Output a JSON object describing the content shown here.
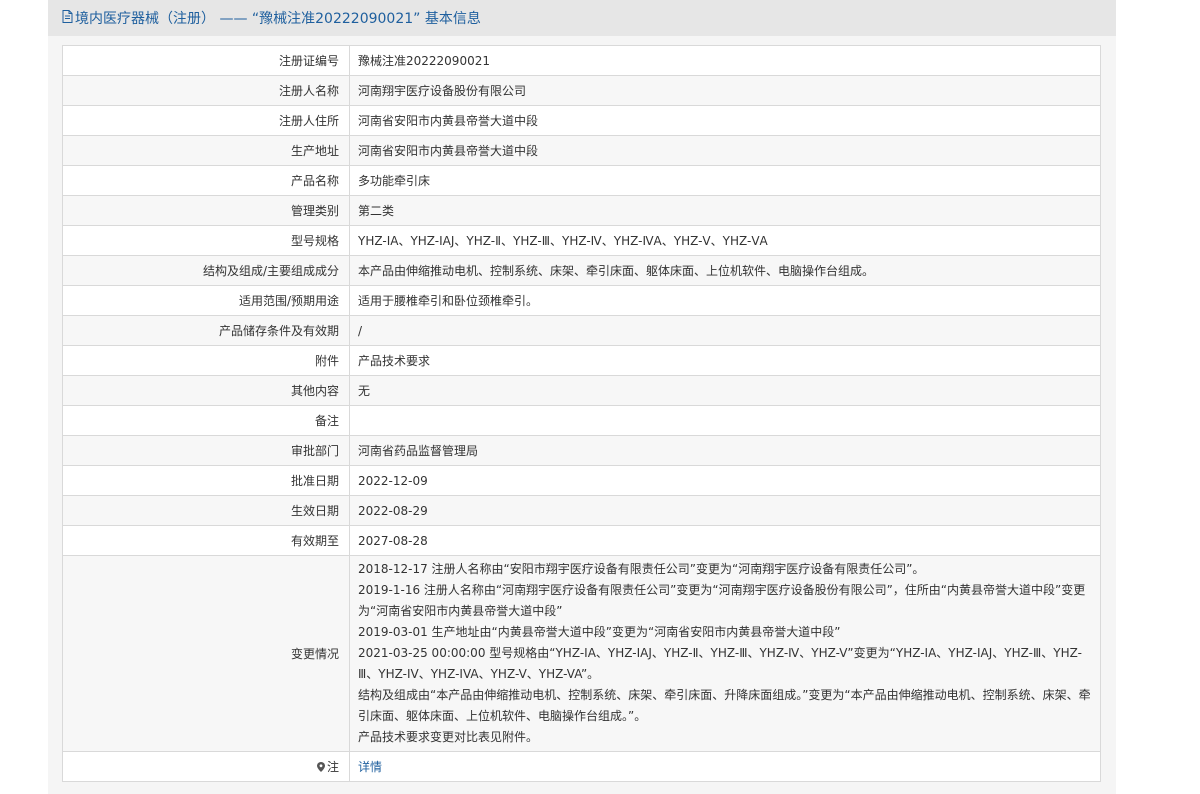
{
  "header": {
    "title": "境内医疗器械（注册） —— “豫械注准20222090021” 基本信息"
  },
  "rows": [
    {
      "label": "注册证编号",
      "value": "豫械注准20222090021"
    },
    {
      "label": "注册人名称",
      "value": "河南翔宇医疗设备股份有限公司"
    },
    {
      "label": "注册人住所",
      "value": "河南省安阳市内黄县帝誉大道中段"
    },
    {
      "label": "生产地址",
      "value": "河南省安阳市内黄县帝誉大道中段"
    },
    {
      "label": "产品名称",
      "value": "多功能牵引床"
    },
    {
      "label": "管理类别",
      "value": "第二类"
    },
    {
      "label": "型号规格",
      "value": "YHZ-ⅠA、YHZ-ⅠAJ、YHZ-Ⅱ、YHZ-Ⅲ、YHZ-Ⅳ、YHZ-ⅣA、YHZ-Ⅴ、YHZ-ⅤA"
    },
    {
      "label": "结构及组成/主要组成成分",
      "value": "本产品由伸缩推动电机、控制系统、床架、牵引床面、躯体床面、上位机软件、电脑操作台组成。"
    },
    {
      "label": "适用范围/预期用途",
      "value": "适用于腰椎牵引和卧位颈椎牵引。"
    },
    {
      "label": "产品储存条件及有效期",
      "value": "/"
    },
    {
      "label": "附件",
      "value": "产品技术要求"
    },
    {
      "label": "其他内容",
      "value": "无"
    },
    {
      "label": "备注",
      "value": ""
    },
    {
      "label": "审批部门",
      "value": "河南省药品监督管理局"
    },
    {
      "label": "批准日期",
      "value": "2022-12-09"
    },
    {
      "label": "生效日期",
      "value": "2022-08-29"
    },
    {
      "label": "有效期至",
      "value": "2027-08-28"
    }
  ],
  "changes": {
    "label": "变更情况",
    "lines": [
      "2018-12-17 注册人名称由“安阳市翔宇医疗设备有限责任公司”变更为“河南翔宇医疗设备有限责任公司”。",
      "2019-1-16 注册人名称由“河南翔宇医疗设备有限责任公司”变更为“河南翔宇医疗设备股份有限公司”，住所由“内黄县帝誉大道中段”变更为“河南省安阳市内黄县帝誉大道中段”",
      "2019-03-01 生产地址由“内黄县帝誉大道中段”变更为“河南省安阳市内黄县帝誉大道中段”",
      "2021-03-25 00:00:00 型号规格由“YHZ-IA、YHZ-IAJ、YHZ-Ⅱ、YHZ-Ⅲ、YHZ-Ⅳ、YHZ-V”变更为“YHZ-IA、YHZ-IAJ、YHZ-Ⅲ、YHZ-Ⅲ、YHZ-IV、YHZ-IVA、YHZ-V、YHZ-VA”。",
      "结构及组成由“本产品由伸缩推动电机、控制系统、床架、牵引床面、升降床面组成。”变更为“本产品由伸缩推动电机、控制系统、床架、牵引床面、躯体床面、上位机软件、电脑操作台组成。”。",
      "产品技术要求变更对比表见附件。"
    ]
  },
  "note": {
    "label": "注",
    "link": "详情"
  },
  "icons": {
    "header_icon": "document-icon",
    "note_icon": "map-pin-icon"
  },
  "colors": {
    "link": "#1e5f9e",
    "header_bg": "#e6e6e6",
    "border": "#d9d9d9"
  }
}
